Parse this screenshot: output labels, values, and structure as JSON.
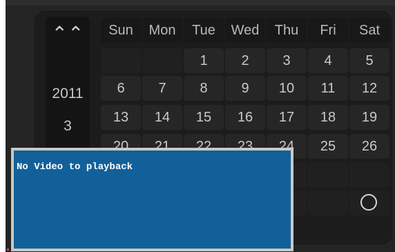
{
  "calendar": {
    "year": "2011",
    "month": "3",
    "up_icon": "double-chevron-up-icon",
    "weekdays": [
      "Sun",
      "Mon",
      "Tue",
      "Wed",
      "Thu",
      "Fri",
      "Sat"
    ],
    "weeks": [
      [
        "",
        "",
        "1",
        "2",
        "3",
        "4",
        "5"
      ],
      [
        "6",
        "7",
        "8",
        "9",
        "10",
        "11",
        "12"
      ],
      [
        "13",
        "14",
        "15",
        "16",
        "17",
        "18",
        "19"
      ],
      [
        "20",
        "21",
        "22",
        "23",
        "24",
        "25",
        "26"
      ],
      [
        "",
        "",
        "",
        "",
        "",
        "",
        ""
      ],
      [
        "",
        "",
        "",
        "",
        "",
        "",
        ""
      ]
    ],
    "today_marker_icon": "circle-icon"
  },
  "popup": {
    "message": "No Video to playback"
  },
  "colors": {
    "popup_background": "#12609a",
    "panel_background": "#1c1c1c"
  }
}
